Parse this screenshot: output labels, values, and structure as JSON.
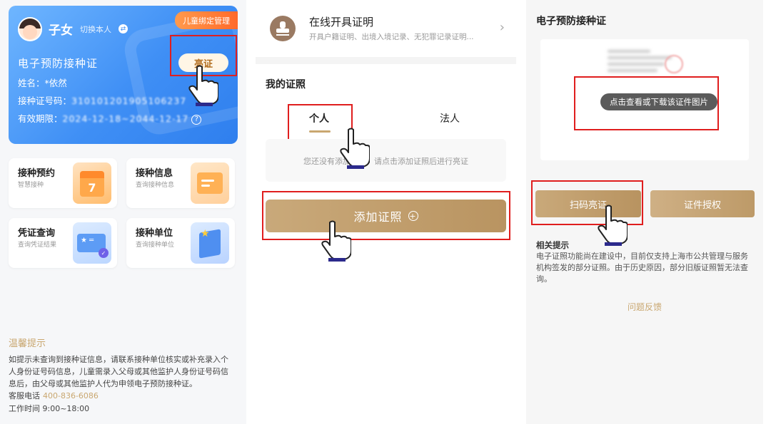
{
  "panel1": {
    "child_mgmt_label": "儿童绑定管理",
    "user_name": "子女",
    "switch_label": "切换本人",
    "cert_title": "电子预防接种证",
    "show_button": "亮证",
    "name_line": "姓名：*依然",
    "cert_no_label": "接种证号码：",
    "cert_no_value": "310101201905106237",
    "validity_label": "有效期限：",
    "validity_value": "2024-12-18~2044-12-17",
    "grid": [
      {
        "title": "接种预约",
        "sub": "智慧接种",
        "icon": "calendar-icon",
        "icon_text": "7"
      },
      {
        "title": "接种信息",
        "sub": "查询接种信息",
        "icon": "folder-icon"
      },
      {
        "title": "凭证查询",
        "sub": "查询凭证结果",
        "icon": "card-icon"
      },
      {
        "title": "接种单位",
        "sub": "查询接种单位",
        "icon": "building-icon"
      }
    ],
    "tips_title": "温馨提示",
    "tips_body": "如提示未查询到接种证信息，请联系接种单位核实或补充录入个人身份证号码信息，儿童需录入父母或其他监护人身份证号码信息后，由父母或其他监护人代为申领电子预防接种证。",
    "phone_label": "客服电话",
    "phone_number": "400-836-6086",
    "hours": "工作时间 9:00~18:00"
  },
  "panel2": {
    "online_title": "在线开具证明",
    "online_sub": "开具户籍证明、出境入境记录、无犯罪记录证明...",
    "my_cert": "我的证照",
    "tab_personal": "个人",
    "tab_legal": "法人",
    "empty_text": "您还没有添加证照，请点击添加证照后进行亮证",
    "add_button": "添加证照"
  },
  "panel3": {
    "title": "电子预防接种证",
    "view_hint": "点击查看或下载该证件图片",
    "scan_button": "扫码亮证",
    "auth_button": "证件授权",
    "rel_title": "相关提示",
    "rel_body": "电子证照功能尚在建设中，目前仅支持上海市公共管理与服务机构签发的部分证照。由于历史原因，部分旧版证照暂无法查询。",
    "feedback": "问题反馈"
  },
  "colors": {
    "accent_gold": "#c9a770",
    "card_blue": "#3f8ff5",
    "highlight_red": "#e01e1e"
  }
}
